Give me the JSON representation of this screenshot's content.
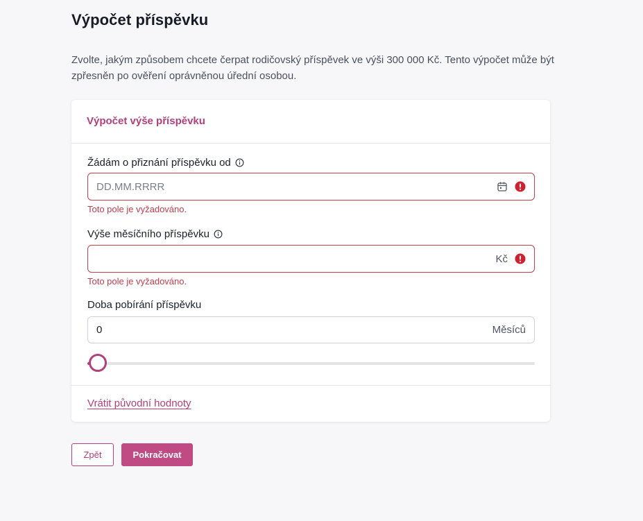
{
  "page": {
    "title": "Výpočet příspěvku",
    "intro": "Zvolte, jakým způsobem chcete čerpat rodičovský příspěvek ve výši 300 000 Kč. Tento výpočet může být zpřesněn po ověření oprávněnou úřední osobou."
  },
  "card": {
    "title": "Výpočet výše příspěvku",
    "fields": {
      "start_date": {
        "label": "Žádám o přiznání příspěvku od",
        "placeholder": "DD.MM.RRRR",
        "value": "",
        "error": "Toto pole je vyžadováno."
      },
      "monthly_amount": {
        "label": "Výše měsíčního příspěvku",
        "value": "",
        "suffix": "Kč",
        "error": "Toto pole je vyžadováno."
      },
      "duration": {
        "label": "Doba pobírání příspěvku",
        "value": "0",
        "suffix": "Měsíců",
        "slider_fraction": 0
      }
    },
    "reset_label": "Vrátit původní hodnoty"
  },
  "actions": {
    "back_label": "Zpět",
    "next_label": "Pokračovat"
  },
  "icons": {
    "info": "info-icon",
    "calendar": "calendar-icon",
    "error": "error-icon"
  },
  "colors": {
    "accent": "#b2407a",
    "error": "#c43d4b",
    "primary_button": "#bf4a84"
  }
}
